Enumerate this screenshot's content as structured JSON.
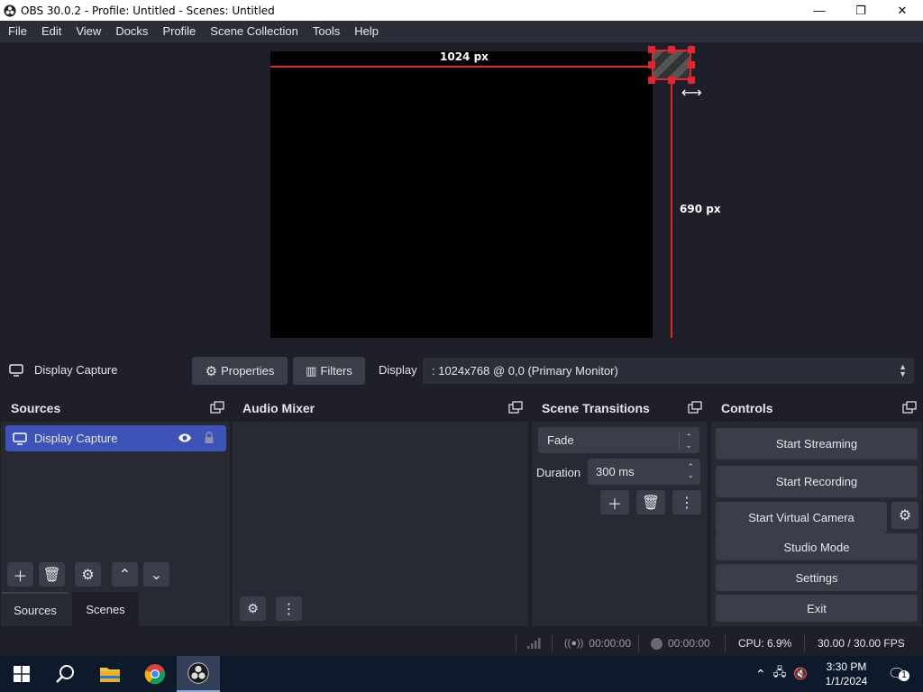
{
  "window": {
    "title": "OBS 30.0.2 - Profile: Untitled - Scenes: Untitled",
    "minimize_glyph": "—",
    "maximize_glyph": "❐",
    "close_glyph": "✕"
  },
  "menu": {
    "items": [
      "File",
      "Edit",
      "View",
      "Docks",
      "Profile",
      "Scene Collection",
      "Tools",
      "Help"
    ]
  },
  "preview": {
    "width_label": "1024 px",
    "height_label": "690 px"
  },
  "context_bar": {
    "source_name": "Display Capture",
    "properties_label": "Properties",
    "filters_label": "Filters",
    "display_label": "Display",
    "display_value": ": 1024x768 @ 0,0 (Primary Monitor)"
  },
  "sources_dock": {
    "title": "Sources",
    "items": [
      {
        "name": "Display Capture",
        "visible": true,
        "locked": false
      }
    ]
  },
  "audio_mixer": {
    "title": "Audio Mixer"
  },
  "scene_transitions": {
    "title": "Scene Transitions",
    "transition": "Fade",
    "duration_label": "Duration",
    "duration_value": "300 ms"
  },
  "controls": {
    "title": "Controls",
    "start_streaming": "Start Streaming",
    "start_recording": "Start Recording",
    "start_virtual_camera": "Start Virtual Camera",
    "studio_mode": "Studio Mode",
    "settings": "Settings",
    "exit": "Exit"
  },
  "tabs": {
    "sources": "Sources",
    "scenes": "Scenes",
    "active": "Sources"
  },
  "status": {
    "stream_time": "00:00:00",
    "record_time": "00:00:00",
    "cpu": "CPU: 6.9%",
    "fps": "30.00 / 30.00 FPS"
  },
  "taskbar": {
    "time": "3:30 PM",
    "date": "1/1/2024",
    "notification_count": "1"
  },
  "colors": {
    "accent_blue": "#3d53b8",
    "guide_red": "#e2262f",
    "dock_bg": "#272a33",
    "window_bg": "#1e1f29"
  }
}
